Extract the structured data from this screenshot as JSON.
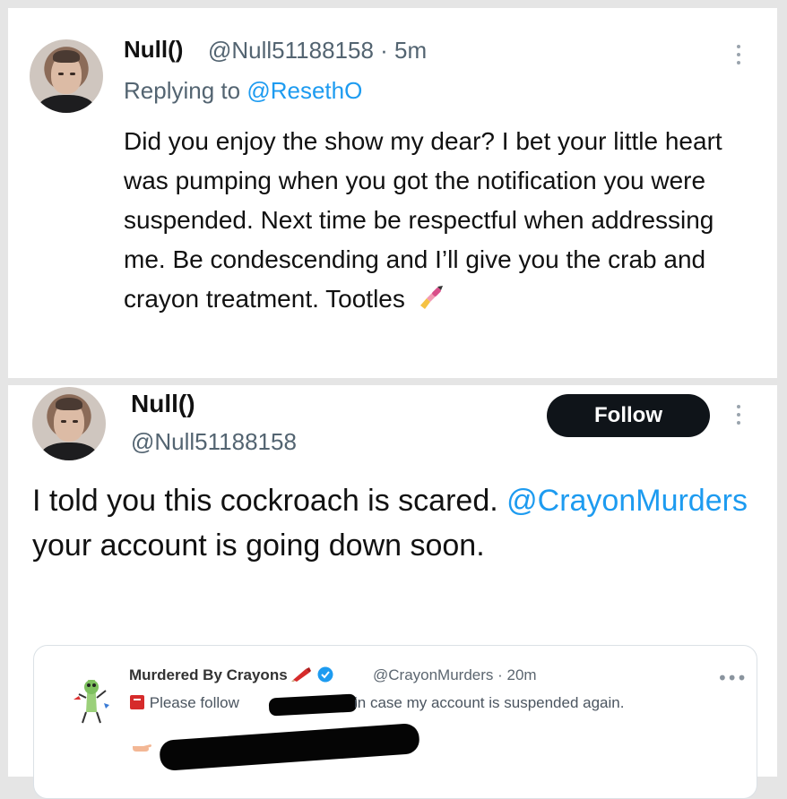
{
  "tweet1": {
    "display_name": "Null()",
    "handle_time": "@Null51188158 · 5m",
    "reply_prefix": "Replying to ",
    "reply_mention": "@ResethO",
    "text": "Did you enjoy the show my dear? I bet your little heart was pumping when you got the notification you were suspended. Next time be respectful when addressing me. Be condescending and I’ll give you the crab and crayon treatment. Tootles",
    "emoji": "nail-polish-emoji"
  },
  "tweet2": {
    "display_name": "Null()",
    "handle": "@Null51188158",
    "follow_label": "Follow",
    "text_before": "I told you this cockroach is scared. ",
    "mention": "@CrayonMurders",
    "text_after": " your account is going down soon."
  },
  "quote": {
    "display_name": "Murdered By Crayons",
    "handle_time": "@CrayonMurders · 20m",
    "line_prefix": "Please follow",
    "line_suffix": "in case my account is suspended again.",
    "icons": [
      "crayon-icon",
      "verified-badge-icon",
      "red-square-icon",
      "pointing-hand-icon"
    ]
  },
  "colors": {
    "link": "#1d9bf0",
    "secondary_text": "#536471",
    "follow_button": "#0f1419",
    "background_gap": "#e5e5e5"
  }
}
